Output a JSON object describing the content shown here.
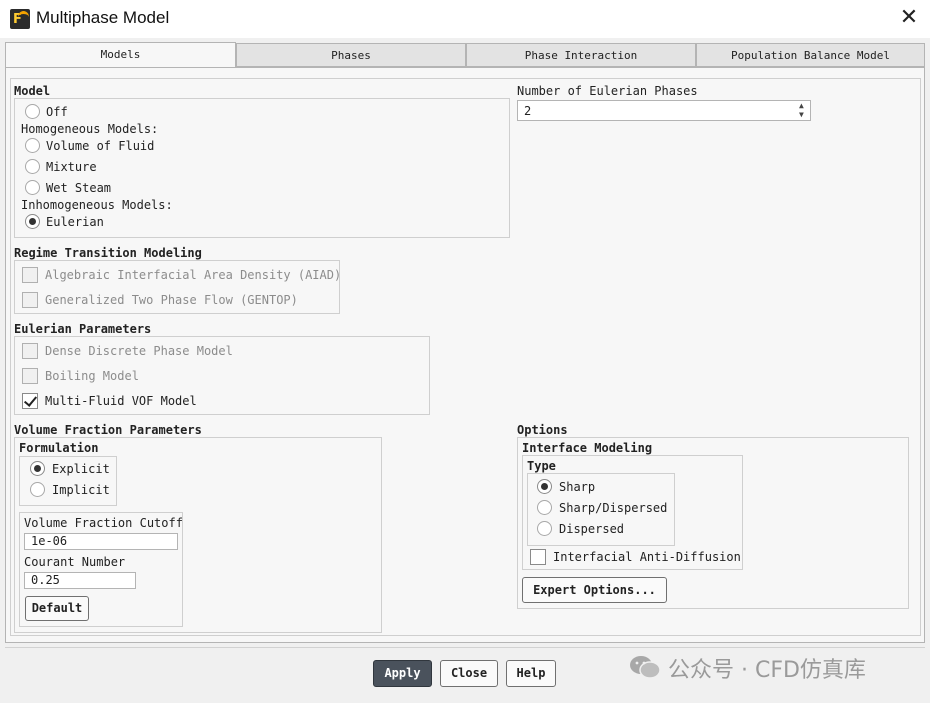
{
  "window": {
    "title": "Multiphase Model",
    "close_glyph": "✕"
  },
  "tabs": [
    {
      "label": "Models",
      "active": true
    },
    {
      "label": "Phases",
      "active": false
    },
    {
      "label": "Phase Interaction",
      "active": false
    },
    {
      "label": "Population Balance Model",
      "active": false
    }
  ],
  "model": {
    "section_label": "Model",
    "off_label": "Off",
    "homogeneous_label": "Homogeneous Models:",
    "vof_label": "Volume of Fluid",
    "mixture_label": "Mixture",
    "wet_steam_label": "Wet Steam",
    "inhomogeneous_label": "Inhomogeneous Models:",
    "eulerian_label": "Eulerian",
    "selected": "Eulerian"
  },
  "eulerian_phases": {
    "label": "Number of Eulerian Phases",
    "value": "2"
  },
  "regime_transition": {
    "section_label": "Regime Transition Modeling",
    "aiad_label": "Algebraic Interfacial Area Density (AIAD)",
    "gentop_label": "Generalized Two Phase Flow (GENTOP)"
  },
  "eulerian_parameters": {
    "section_label": "Eulerian Parameters",
    "ddpm_label": "Dense Discrete Phase Model",
    "boiling_label": "Boiling Model",
    "mfvof_label": "Multi-Fluid VOF Model",
    "mfvof_checked": true
  },
  "vf_params": {
    "section_label": "Volume Fraction Parameters",
    "formulation_label": "Formulation",
    "explicit_label": "Explicit",
    "implicit_label": "Implicit",
    "formulation_selected": "Explicit",
    "cutoff_label": "Volume Fraction Cutoff",
    "cutoff_value": "1e-06",
    "courant_label": "Courant Number",
    "courant_value": "0.25",
    "default_button": "Default"
  },
  "options": {
    "section_label": "Options",
    "interface_label": "Interface Modeling",
    "type_label": "Type",
    "sharp_label": "Sharp",
    "sharp_dispersed_label": "Sharp/Dispersed",
    "dispersed_label": "Dispersed",
    "type_selected": "Sharp",
    "anti_diffusion_label": "Interfacial Anti-Diffusion",
    "expert_button": "Expert Options..."
  },
  "footer": {
    "apply": "Apply",
    "close": "Close",
    "help": "Help"
  },
  "watermark": {
    "text": "公众号 · CFD仿真库"
  },
  "colors": {
    "primary_button": "#4a525c",
    "panel": "#f7f7f7",
    "background": "#f0f0f0"
  },
  "icons": {
    "app": "fluent-app-icon",
    "watermark": "wechat-icon"
  }
}
